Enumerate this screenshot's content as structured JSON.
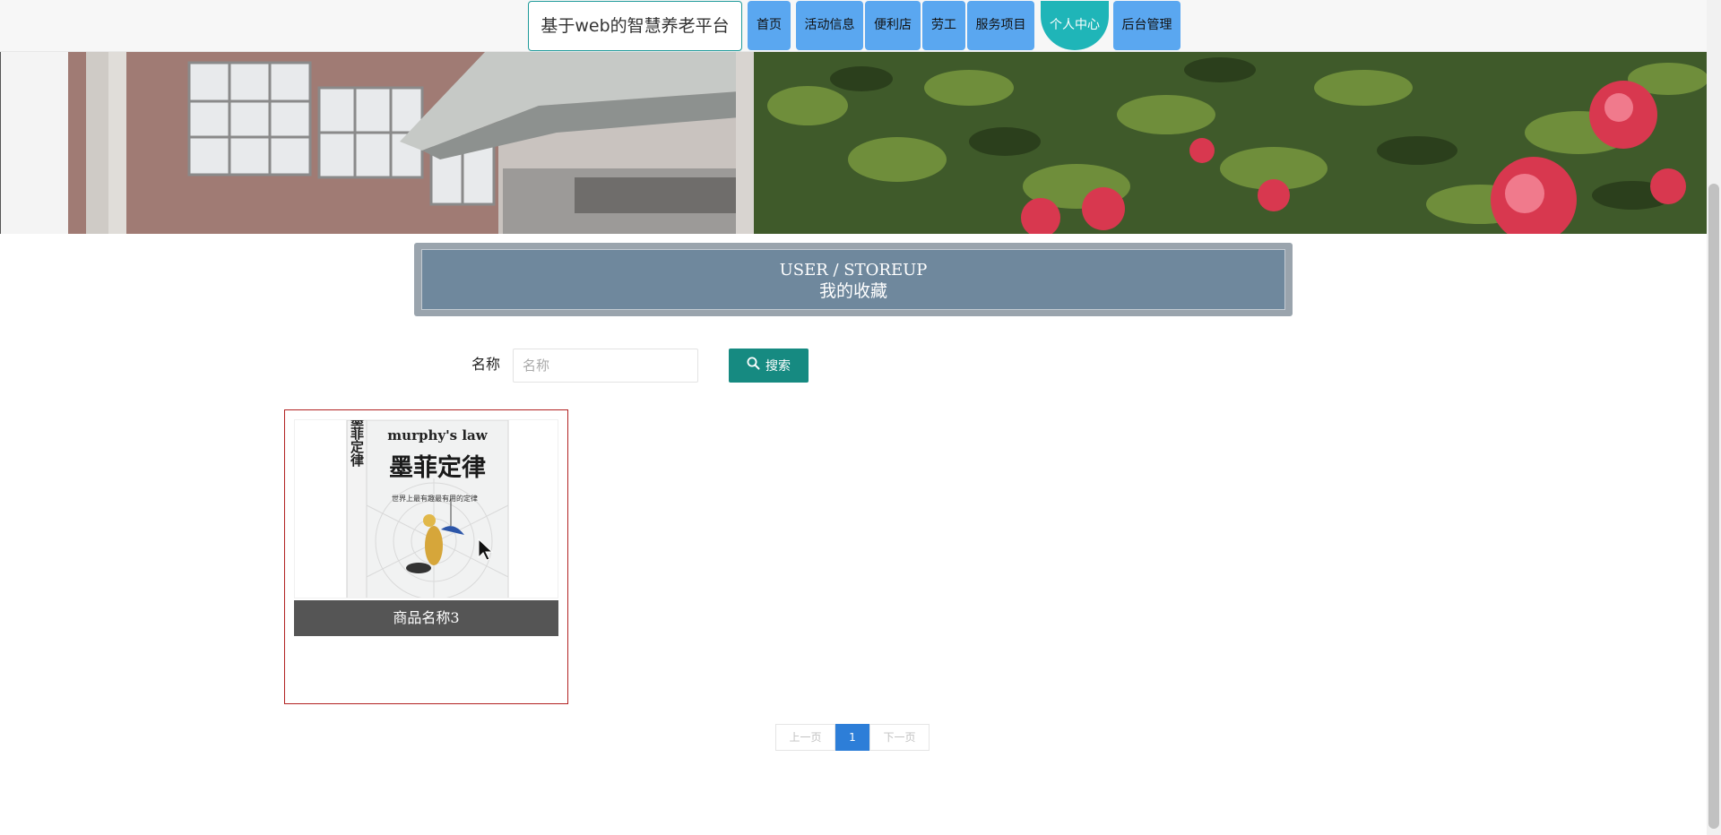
{
  "header": {
    "site_title": "基于web的智慧养老平台",
    "nav": [
      {
        "label": "首页"
      },
      {
        "label": "活动信息"
      },
      {
        "label": "便利店"
      },
      {
        "label": "劳工"
      },
      {
        "label": "服务项目"
      },
      {
        "label": "个人中心",
        "active": true
      },
      {
        "label": "后台管理"
      }
    ]
  },
  "section": {
    "title_en": "USER / STOREUP",
    "title_cn": "我的收藏"
  },
  "search": {
    "label": "名称",
    "placeholder": "名称",
    "value": "",
    "button_label": "搜索",
    "button_icon": "search-icon"
  },
  "items": [
    {
      "name": "商品名称3",
      "image": {
        "title_en": "murphy's law",
        "title_cn": "墨菲定律",
        "spine_text": "墨菲定律",
        "subtitle": "世界上最有趣最有用的定律"
      }
    }
  ],
  "pagination": {
    "prev": "上一页",
    "current": "1",
    "next": "下一页"
  },
  "colors": {
    "nav_button": "#5aa7f0",
    "nav_active": "#1fb5b8",
    "search_button": "#168a81",
    "section_head": "#6f889d",
    "card_border": "#b22222",
    "pager_current": "#2d7ed8"
  }
}
